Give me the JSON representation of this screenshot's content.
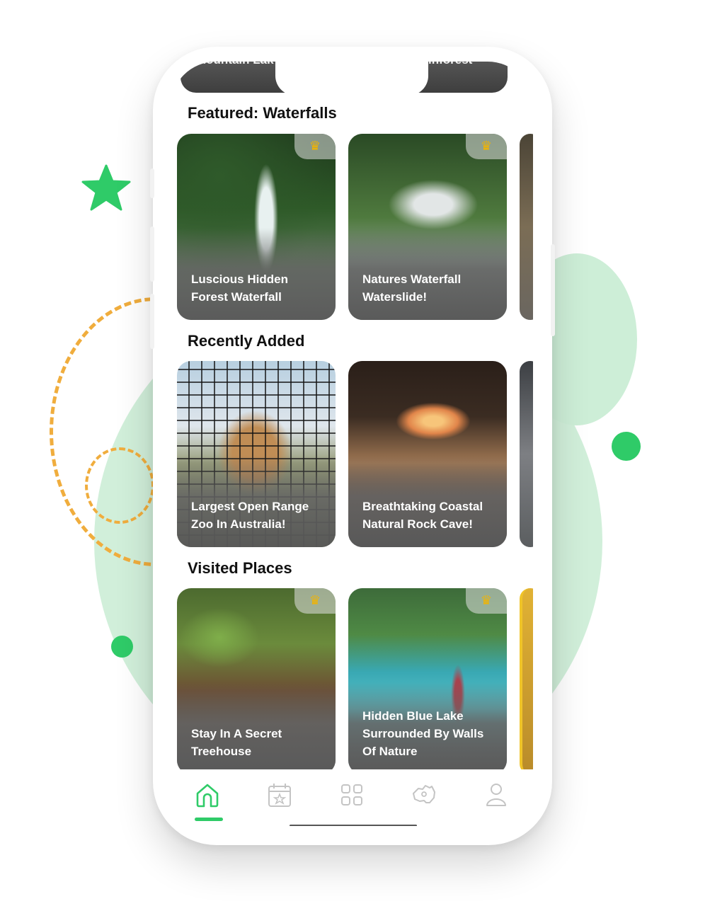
{
  "top_strip": {
    "left_text": "Mountain Lak",
    "right_text": "inforest"
  },
  "sections": [
    {
      "title": "Featured:  Waterfalls"
    },
    {
      "title": "Recently Added"
    },
    {
      "title": "Visited Places"
    }
  ],
  "featured": [
    {
      "title": "Luscious Hidden Forest Waterfall",
      "crown": "♛"
    },
    {
      "title": "Natures Waterfall Waterslide!",
      "crown": "♛"
    }
  ],
  "recent": [
    {
      "title": "Largest Open Range Zoo In Australia!"
    },
    {
      "title": "Breathtaking Coastal Natural Rock Cave!"
    }
  ],
  "visited": [
    {
      "title": "Stay In A Secret Treehouse",
      "crown": "♛"
    },
    {
      "title": "Hidden Blue Lake Surrounded By Walls Of Nature",
      "crown": "♛"
    }
  ],
  "nav": {
    "items": [
      "home-icon",
      "calendar-star-icon",
      "grid-icon",
      "australia-map-icon",
      "profile-icon"
    ],
    "active": "home-icon"
  },
  "colors": {
    "accent": "#2fcb68",
    "dash": "#f0ad3d",
    "crown": "#f2b400"
  }
}
